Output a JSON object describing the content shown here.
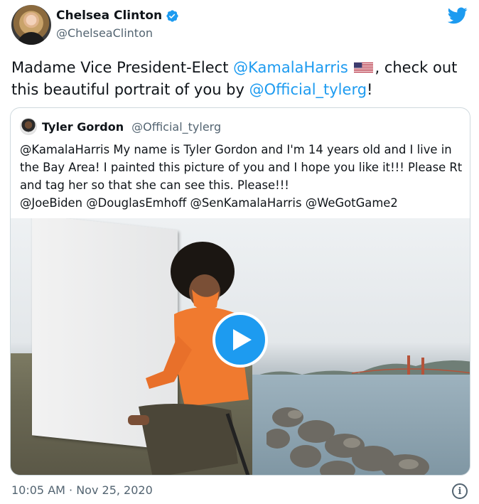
{
  "author": {
    "display_name": "Chelsea Clinton",
    "handle": "@ChelseaClinton",
    "verified": true
  },
  "tweet": {
    "part1": "Madame Vice President-Elect ",
    "mention1": "@KamalaHarris",
    "flag": "us-flag",
    "part2": ", check out this beautiful portrait of you by ",
    "mention2": "@Official_tylerg",
    "part3": "!"
  },
  "quoted": {
    "display_name": "Tyler Gordon",
    "handle": "@Official_tylerg",
    "mention_lead": "@KamalaHarris",
    "body": " My name is Tyler Gordon and I'm 14 years old and I live in the Bay Area! I painted this picture of you and I hope you like it!!! Please Rt and tag her so that she can see this. Please!!!",
    "mentions": [
      "@JoeBiden",
      "@DouglasEmhoff",
      "@SenKamalaHarris",
      "@WeGotGame2"
    ]
  },
  "media": {
    "type": "video",
    "play_icon": "play-icon"
  },
  "footer": {
    "timestamp": "10:05 AM · Nov 25, 2020",
    "info_icon": "info-icon"
  },
  "colors": {
    "link": "#1d9bf0",
    "text": "#0f1419",
    "secondary": "#536471",
    "border": "#cfd9de"
  }
}
